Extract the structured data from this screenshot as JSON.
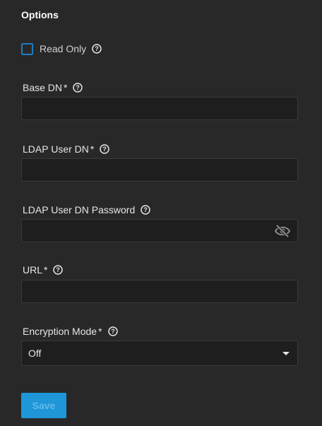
{
  "section": {
    "title": "Options"
  },
  "read_only": {
    "label": "Read Only",
    "checked": false
  },
  "fields": {
    "base_dn": {
      "label": "Base DN",
      "required_mark": "*",
      "value": ""
    },
    "ldap_user_dn": {
      "label": "LDAP User DN",
      "required_mark": "*",
      "value": ""
    },
    "ldap_user_dn_password": {
      "label": "LDAP User DN Password",
      "value": ""
    },
    "url": {
      "label": "URL",
      "required_mark": "*",
      "value": ""
    },
    "encryption_mode": {
      "label": "Encryption Mode",
      "required_mark": "*",
      "selected": "Off"
    }
  },
  "actions": {
    "save_label": "Save"
  },
  "colors": {
    "background": "#282828",
    "input_background": "#1e1e1e",
    "accent": "#1e96d8"
  },
  "icons": {
    "help": "help-circle-icon",
    "visibility": "eye-off-icon",
    "dropdown": "caret-down-icon"
  }
}
